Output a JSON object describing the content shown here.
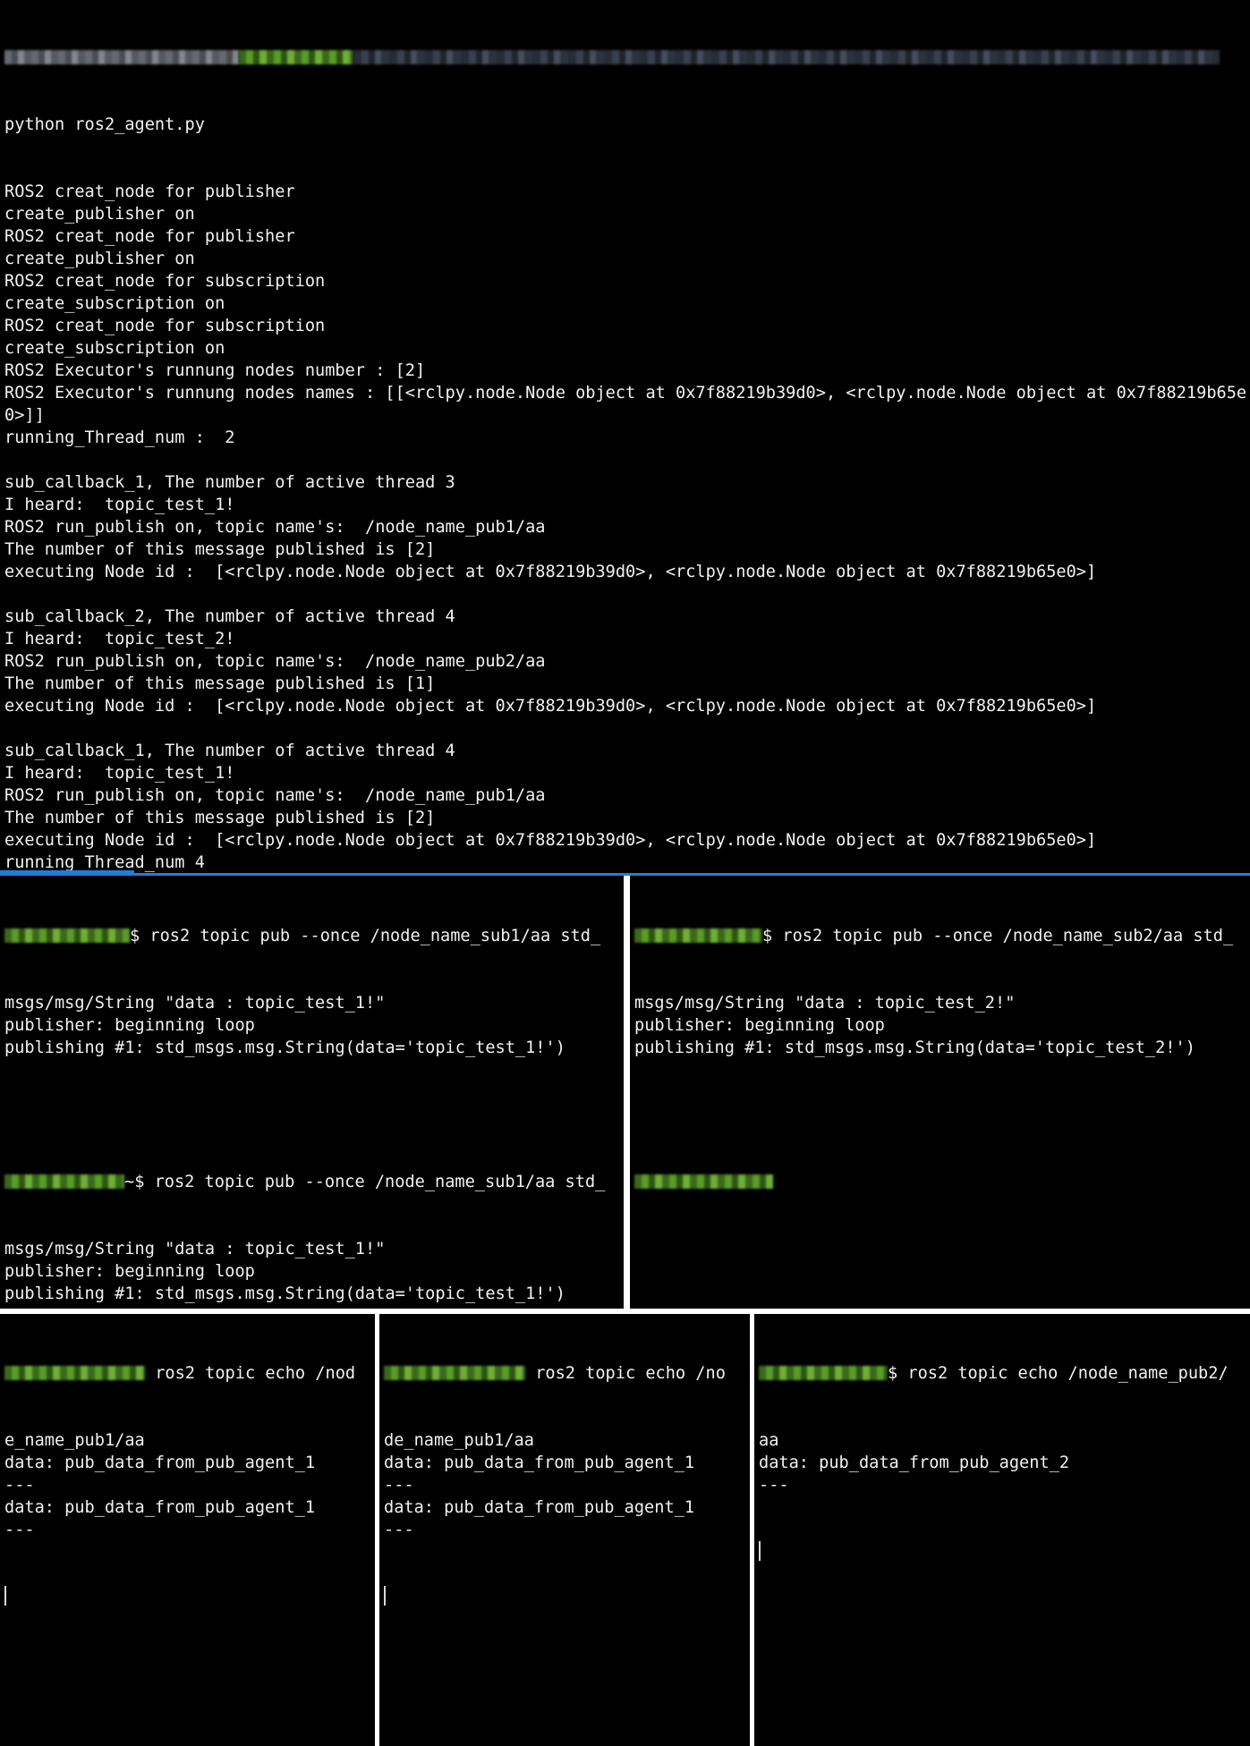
{
  "top_terminal": {
    "command": "python ros2_agent.py",
    "lines": [
      "ROS2 creat_node for publisher",
      "create_publisher on",
      "ROS2 creat_node for publisher",
      "create_publisher on",
      "ROS2 creat_node for subscription",
      "create_subscription on",
      "ROS2 creat_node for subscription",
      "create_subscription on",
      "ROS2 Executor's runnung nodes number : [2]",
      "ROS2 Executor's runnung nodes names : [[<rclpy.node.Node object at 0x7f88219b39d0>, <rclpy.node.Node object at 0x7f88219b65e",
      "0>]]",
      "running_Thread_num :  2",
      "",
      "sub_callback_1, The number of active thread 3",
      "I heard:  topic_test_1!",
      "ROS2 run_publish on, topic name's:  /node_name_pub1/aa",
      "The number of this message published is [2]",
      "executing Node id :  [<rclpy.node.Node object at 0x7f88219b39d0>, <rclpy.node.Node object at 0x7f88219b65e0>]",
      "",
      "sub_callback_2, The number of active thread 4",
      "I heard:  topic_test_2!",
      "ROS2 run_publish on, topic name's:  /node_name_pub2/aa",
      "The number of this message published is [1]",
      "executing Node id :  [<rclpy.node.Node object at 0x7f88219b39d0>, <rclpy.node.Node object at 0x7f88219b65e0>]",
      "",
      "sub_callback_1, The number of active thread 4",
      "I heard:  topic_test_1!",
      "ROS2 run_publish on, topic name's:  /node_name_pub1/aa",
      "The number of this message published is [2]",
      "executing Node id :  [<rclpy.node.Node object at 0x7f88219b39d0>, <rclpy.node.Node object at 0x7f88219b65e0>]",
      "running_Thread_num 4"
    ]
  },
  "pub_left": {
    "block1": {
      "prompt_suffix": "$ ros2 topic pub --once /node_name_sub1/aa std_",
      "lines": [
        "msgs/msg/String \"data : topic_test_1!\"",
        "publisher: beginning loop",
        "publishing #1: std_msgs.msg.String(data='topic_test_1!')"
      ]
    },
    "block2": {
      "prompt_suffix": "~$ ros2 topic pub --once /node_name_sub1/aa std_",
      "lines": [
        "msgs/msg/String \"data : topic_test_1!\"",
        "publisher: beginning loop",
        "publishing #1: std_msgs.msg.String(data='topic_test_1!')"
      ]
    }
  },
  "pub_right": {
    "prompt_suffix": "$ ros2 topic pub --once /node_name_sub2/aa std_",
    "lines": [
      "msgs/msg/String \"data : topic_test_2!\"",
      "publisher: beginning loop",
      "publishing #1: std_msgs.msg.String(data='topic_test_2!')"
    ]
  },
  "echo_1": {
    "prompt_suffix": " ros2 topic echo /nod",
    "lines": [
      "e_name_pub1/aa",
      "data: pub_data_from_pub_agent_1",
      "---",
      "data: pub_data_from_pub_agent_1",
      "---"
    ]
  },
  "echo_2": {
    "prompt_suffix": " ros2 topic echo /no",
    "lines": [
      "de_name_pub1/aa",
      "data: pub_data_from_pub_agent_1",
      "---",
      "data: pub_data_from_pub_agent_1",
      "---"
    ]
  },
  "echo_3": {
    "prompt_suffix": "$ ros2 topic echo /node_name_pub2/",
    "lines": [
      "aa",
      "data: pub_data_from_pub_agent_2",
      "---"
    ]
  },
  "colors": {
    "background": "#000000",
    "text": "#f2f2f2",
    "divider": "#ffffff",
    "accent": "#1e7fd9"
  }
}
